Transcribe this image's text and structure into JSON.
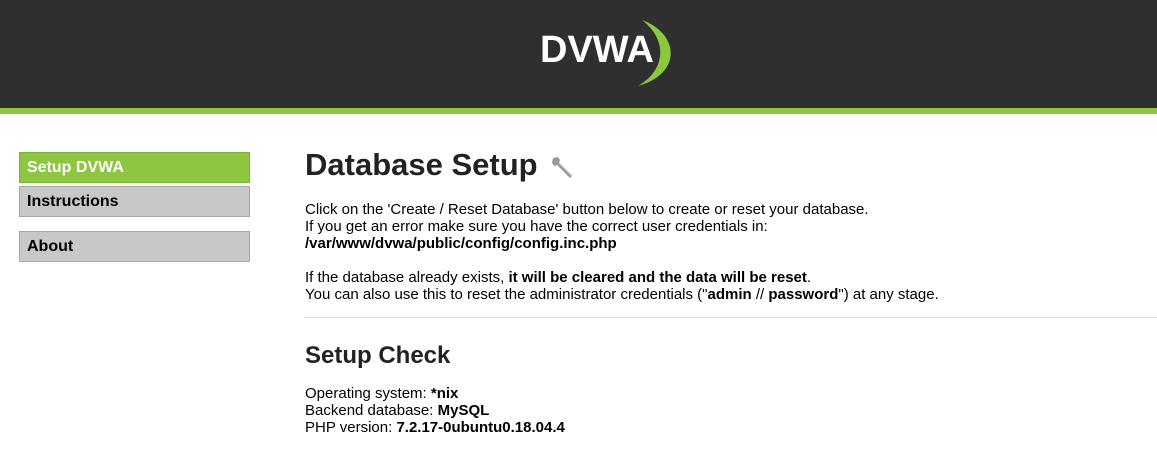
{
  "header": {
    "logo_text": "DVWA",
    "brand_color": "#8dc63f",
    "background": "#2f2f2f"
  },
  "menu": {
    "items": [
      {
        "label": "Setup DVWA",
        "selected": true
      },
      {
        "label": "Instructions",
        "selected": false
      },
      {
        "label": "About",
        "selected": false
      }
    ]
  },
  "main": {
    "title": "Database Setup",
    "title_icon": "wrench-icon",
    "intro": {
      "line1": "Click on the 'Create / Reset Database' button below to create or reset your database.",
      "line2": "If you get an error make sure you have the correct user credentials in:",
      "config_path": "/var/www/dvwa/public/config/config.inc.php"
    },
    "info": {
      "line1_pre": "If the database already exists, ",
      "line1_bold": "it will be cleared and the data will be reset",
      "line1_post": ".",
      "line2_pre": "You can also use this to reset the administrator credentials (\"",
      "admin_user": "admin",
      "separator": " // ",
      "admin_pass": "password",
      "line2_post": "\") at any stage."
    },
    "setup_check": {
      "title": "Setup Check",
      "os_label": "Operating system: ",
      "os_value": "*nix",
      "db_label": "Backend database: ",
      "db_value": "MySQL",
      "php_label": "PHP version: ",
      "php_value": "7.2.17-0ubuntu0.18.04.4"
    }
  }
}
